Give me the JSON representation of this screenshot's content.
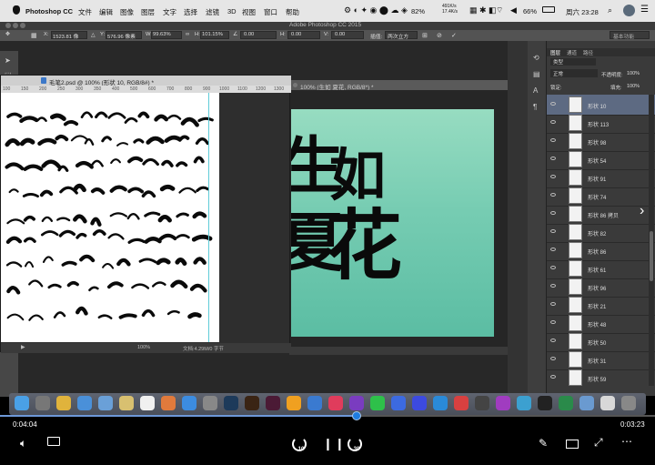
{
  "menubar": {
    "app_name": "Photoshop CC",
    "menus": [
      "文件",
      "编辑",
      "图像",
      "图层",
      "文字",
      "选择",
      "滤镜",
      "3D",
      "视图",
      "窗口",
      "帮助"
    ],
    "battery": "82%",
    "net_speed_up": "491K/s",
    "net_speed_down": "17.4K/s",
    "battery2": "66%",
    "clock": "周六 23:28"
  },
  "window": {
    "title": "Adobe Photoshop CC 2015"
  },
  "options": {
    "x_label": "X:",
    "x_value": "1523.81 像",
    "y_label": "Y:",
    "y_value": "576.96 像素",
    "w_label": "W:",
    "w_value": "99.63%",
    "h_label": "H:",
    "h_value": "101.15%",
    "angle_value": "0.00",
    "hskew_label": "H:",
    "hskew_value": "0.00",
    "vskew_label": "V:",
    "vskew_value": "0.00",
    "interp_label": "插值:",
    "interp_value": "两次立方",
    "workspace": "基本功能"
  },
  "doc1": {
    "tab": "毛笔2.psd @ 100% (形状 10, RGB/8#) *",
    "ruler_ticks": [
      "100",
      "150",
      "200",
      "250",
      "300",
      "350",
      "400",
      "500",
      "600",
      "700",
      "800",
      "900",
      "1000",
      "1100",
      "1200",
      "1300"
    ],
    "status_zoom": "100%",
    "status_doc": "文档:4.29M/0 字节"
  },
  "doc2": {
    "tab": "100% (生如 夏花, RGB/8*) *",
    "line1_a": "生",
    "line1_b": "如",
    "line2_a": "夏",
    "line2_b": "花"
  },
  "layers_panel": {
    "tabs": [
      "图层",
      "通道",
      "路径"
    ],
    "kind": "类型",
    "blend_mode": "正常",
    "opacity_label": "不透明度:",
    "opacity": "100%",
    "lock_label": "锁定:",
    "fill_label": "填充:",
    "fill": "100%",
    "layers": [
      "形状 10",
      "形状 113",
      "形状 98",
      "形状 54",
      "形状 91",
      "形状 74",
      "形状 86 拷贝",
      "形状 82",
      "形状 86",
      "形状 61",
      "形状 96",
      "形状 21",
      "形状 48",
      "形状 50",
      "形状 31",
      "形状 59"
    ],
    "selected_index": 0
  },
  "player": {
    "elapsed": "0:04:04",
    "remaining": "0:03:23",
    "progress": 0.545,
    "skip_back": "10",
    "skip_forward": "30"
  },
  "dock_icons": [
    "finder",
    "launchpad",
    "chrome",
    "safari",
    "mail",
    "notes",
    "calendar",
    "photos",
    "appstore",
    "preferences",
    "photoshop",
    "illustrator",
    "indesign",
    "sketch",
    "xcode",
    "music",
    "pp",
    "wechat",
    "qq",
    "baidu",
    "vpn",
    "mail2",
    "game",
    "rp",
    "browser",
    "terminal",
    "excel",
    "folder",
    "docs",
    "trash"
  ]
}
